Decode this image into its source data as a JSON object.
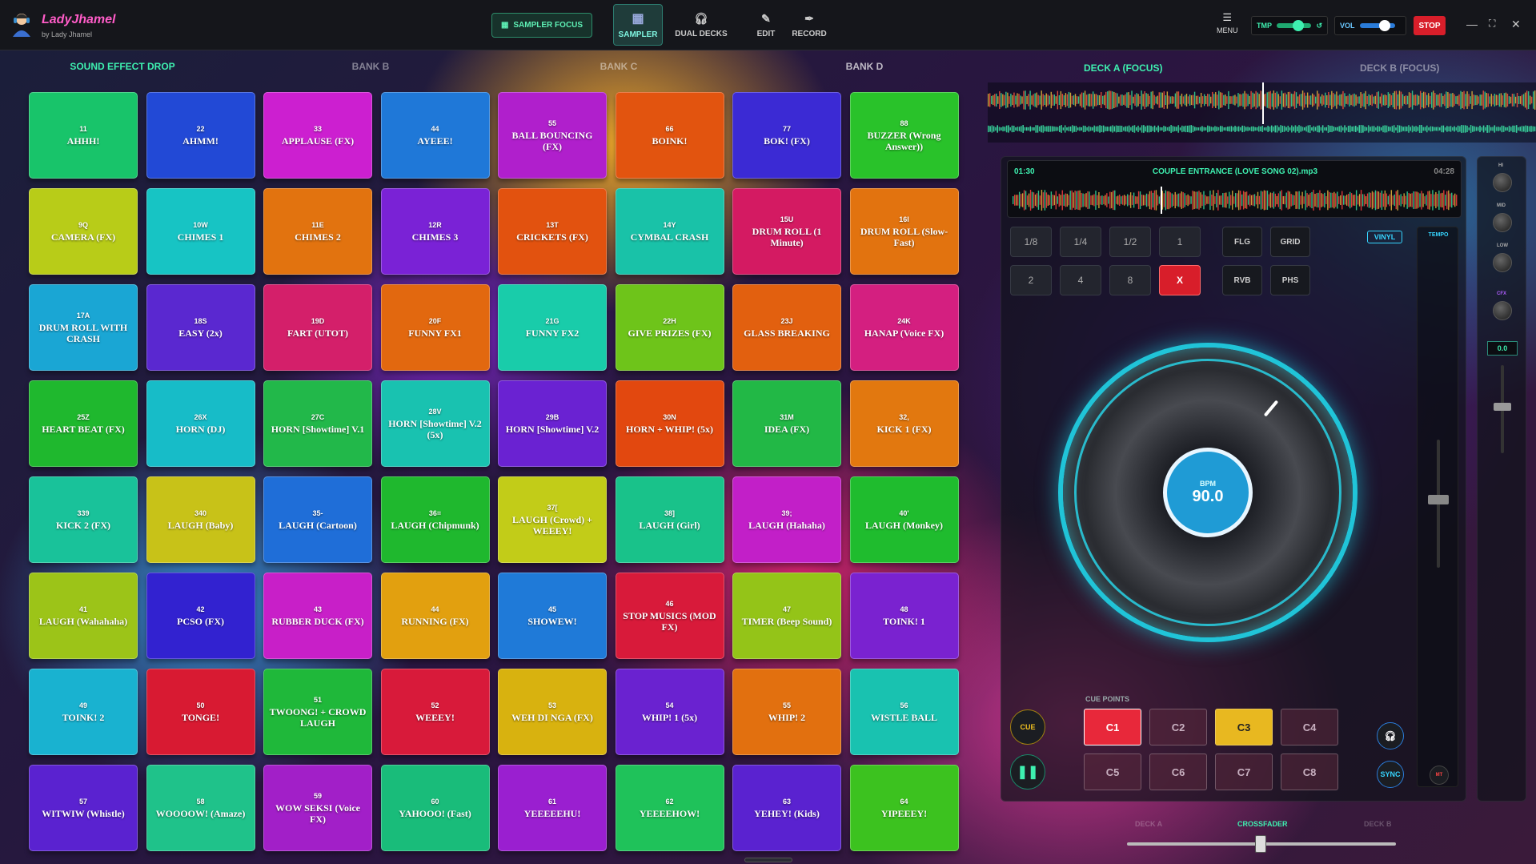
{
  "app": {
    "name": "LadyJhamel",
    "subtitle": "by Lady Jhamel"
  },
  "toolbar": {
    "sampler_focus": "SAMPLER FOCUS",
    "nav": [
      {
        "label": "SAMPLER",
        "icon": "grid-icon"
      },
      {
        "label": "DUAL DECKS",
        "icon": "headphones-icon"
      },
      {
        "label": "EDIT",
        "icon": "pencil-icon"
      },
      {
        "label": "RECORD",
        "icon": "pen-nib-icon"
      }
    ],
    "menu": "MENU",
    "tmp": "TMP",
    "vol": "VOL",
    "tmp_level": 0.6,
    "vol_level": 0.7,
    "stop": "STOP"
  },
  "colors": {
    "accent": "#36d5ff",
    "tab_active": "#3ef0b0",
    "stop": "#d81e2a"
  },
  "banks": [
    {
      "label": "SOUND EFFECT DROP",
      "active": true
    },
    {
      "label": "BANK B",
      "active": false
    },
    {
      "label": "BANK C",
      "active": false
    },
    {
      "label": "BANK D",
      "active": false
    }
  ],
  "pads": [
    {
      "n": "11",
      "l": "AHHH!",
      "c": "#18c46a"
    },
    {
      "n": "22",
      "l": "AHMM!",
      "c": "#2249d6"
    },
    {
      "n": "33",
      "l": "APPLAUSE (FX)",
      "c": "#cc1fd0"
    },
    {
      "n": "44",
      "l": "AYEEE!",
      "c": "#1f78d8"
    },
    {
      "n": "55",
      "l": "BALL BOUNCING (FX)",
      "c": "#b01fcc"
    },
    {
      "n": "66",
      "l": "BOINK!",
      "c": "#e2540f"
    },
    {
      "n": "77",
      "l": "BOK! (FX)",
      "c": "#3b2ad4"
    },
    {
      "n": "88",
      "l": "BUZZER (Wrong Answer))",
      "c": "#29c22a"
    },
    {
      "n": "9Q",
      "l": "CAMERA (FX)",
      "c": "#b8cc18"
    },
    {
      "n": "10W",
      "l": "CHIMES 1",
      "c": "#17c4c4"
    },
    {
      "n": "11E",
      "l": "CHIMES 2",
      "c": "#e2730f"
    },
    {
      "n": "12R",
      "l": "CHIMES 3",
      "c": "#7a22d6"
    },
    {
      "n": "13T",
      "l": "CRICKETS (FX)",
      "c": "#e2520f"
    },
    {
      "n": "14Y",
      "l": "CYMBAL CRASH",
      "c": "#19c2a8"
    },
    {
      "n": "15U",
      "l": "DRUM ROLL (1 Minute)",
      "c": "#d41a62"
    },
    {
      "n": "16I",
      "l": "DRUM ROLL (Slow-Fast)",
      "c": "#e2730f"
    },
    {
      "n": "17A",
      "l": "DRUM ROLL WITH CRASH",
      "c": "#1aa6d4"
    },
    {
      "n": "18S",
      "l": "EASY (2x)",
      "c": "#5a28d0"
    },
    {
      "n": "19D",
      "l": "FART (UTOT)",
      "c": "#d41f6a"
    },
    {
      "n": "20F",
      "l": "FUNNY FX1",
      "c": "#e2680f"
    },
    {
      "n": "21G",
      "l": "FUNNY FX2",
      "c": "#19ccaa"
    },
    {
      "n": "22H",
      "l": "GIVE PRIZES (FX)",
      "c": "#6ec41a"
    },
    {
      "n": "23J",
      "l": "GLASS BREAKING",
      "c": "#e2600f"
    },
    {
      "n": "24K",
      "l": "HANAP (Voice FX)",
      "c": "#d41f80"
    },
    {
      "n": "25Z",
      "l": "HEART BEAT (FX)",
      "c": "#1fb82e"
    },
    {
      "n": "26X",
      "l": "HORN (DJ)",
      "c": "#17bcc8"
    },
    {
      "n": "27C",
      "l": "HORN [Showtime] V.1",
      "c": "#22b84a"
    },
    {
      "n": "28V",
      "l": "HORN [Showtime] V.2 (5x)",
      "c": "#19c2b0"
    },
    {
      "n": "29B",
      "l": "HORN [Showtime] V.2",
      "c": "#6a22d2"
    },
    {
      "n": "30N",
      "l": "HORN + WHIP! (5x)",
      "c": "#e2480f"
    },
    {
      "n": "31M",
      "l": "IDEA (FX)",
      "c": "#22b846"
    },
    {
      "n": "32,",
      "l": "KICK 1 (FX)",
      "c": "#e2780f"
    },
    {
      "n": "339",
      "l": "KICK 2 (FX)",
      "c": "#19c29a"
    },
    {
      "n": "340",
      "l": "LAUGH (Baby)",
      "c": "#c8c218"
    },
    {
      "n": "35-",
      "l": "LAUGH (Cartoon)",
      "c": "#1f6ed8"
    },
    {
      "n": "36=",
      "l": "LAUGH (Chipmunk)",
      "c": "#1fb82e"
    },
    {
      "n": "37[",
      "l": "LAUGH (Crowd) + WEEEY!",
      "c": "#c2cc18"
    },
    {
      "n": "38]",
      "l": "LAUGH (Girl)",
      "c": "#19c28a"
    },
    {
      "n": "39;",
      "l": "LAUGH (Hahaha)",
      "c": "#c21fc8"
    },
    {
      "n": "40'",
      "l": "LAUGH (Monkey)",
      "c": "#1fbc2e"
    },
    {
      "n": "41",
      "l": "LAUGH (Wahahaha)",
      "c": "#9cc418"
    },
    {
      "n": "42",
      "l": "PCSO (FX)",
      "c": "#3222d0"
    },
    {
      "n": "43",
      "l": "RUBBER DUCK (FX)",
      "c": "#c81fc8"
    },
    {
      "n": "44",
      "l": "RUNNING (FX)",
      "c": "#e2a00f"
    },
    {
      "n": "45",
      "l": "SHOWEW!",
      "c": "#1f7ad8"
    },
    {
      "n": "46",
      "l": "STOP MUSICS (MOD FX)",
      "c": "#d81a3a"
    },
    {
      "n": "47",
      "l": "TIMER (Beep Sound)",
      "c": "#94c418"
    },
    {
      "n": "48",
      "l": "TOINK! 1",
      "c": "#7a22d0"
    },
    {
      "n": "49",
      "l": "TOINK! 2",
      "c": "#19b2d0"
    },
    {
      "n": "50",
      "l": "TONGE!",
      "c": "#d81a32"
    },
    {
      "n": "51",
      "l": "TWOONG! + CROWD LAUGH",
      "c": "#1fb83a"
    },
    {
      "n": "52",
      "l": "WEEEY!",
      "c": "#d81a3a"
    },
    {
      "n": "53",
      "l": "WEH DI NGA (FX)",
      "c": "#d8b20f"
    },
    {
      "n": "54",
      "l": "WHIP! 1 (5x)",
      "c": "#6a22d0"
    },
    {
      "n": "55",
      "l": "WHIP! 2",
      "c": "#e2700f"
    },
    {
      "n": "56",
      "l": "WISTLE BALL",
      "c": "#19c2b0"
    },
    {
      "n": "57",
      "l": "WITWIW (Whistle)",
      "c": "#5a22d0"
    },
    {
      "n": "58",
      "l": "WOOOOW! (Amaze)",
      "c": "#1fc28a"
    },
    {
      "n": "59",
      "l": "WOW SEKSI (Voice FX)",
      "c": "#a21fc8"
    },
    {
      "n": "60",
      "l": "YAHOOO! (Fast)",
      "c": "#19bc7a"
    },
    {
      "n": "61",
      "l": "YEEEEEHU!",
      "c": "#9a1fd0"
    },
    {
      "n": "62",
      "l": "YEEEEHOW!",
      "c": "#1fc25a"
    },
    {
      "n": "63",
      "l": "YEHEY! (Kids)",
      "c": "#5a22d0"
    },
    {
      "n": "64",
      "l": "YIPEEEY!",
      "c": "#3cc21f"
    }
  ],
  "deck": {
    "tab_a": "DECK A (FOCUS)",
    "tab_b": "DECK B (FOCUS)",
    "elapsed": "01:30",
    "track": "COUPLE ENTRANCE (LOVE SONG 02).mp3",
    "duration": "04:28",
    "loops": [
      "1/8",
      "1/4",
      "1/2",
      "1",
      "2",
      "4",
      "8",
      "X"
    ],
    "fx": [
      "FLG",
      "GRID",
      "RVB",
      "PHS"
    ],
    "vinyl": "VINYL",
    "tempo": "TEMPO",
    "bpm_label": "BPM",
    "bpm": "90.0",
    "cue": "CUE",
    "cue_points_label": "CUE POINTS",
    "cue_points": [
      "C1",
      "C2",
      "C3",
      "C4",
      "C5",
      "C6",
      "C7",
      "C8"
    ],
    "sync": "SYNC",
    "mt": "MT",
    "eq": [
      "HI",
      "MID",
      "LOW",
      "CFX"
    ],
    "gain": "0.0",
    "crossfader": "CROSSFADER",
    "xfade_left": "DECK A",
    "xfade_right": "DECK B"
  }
}
